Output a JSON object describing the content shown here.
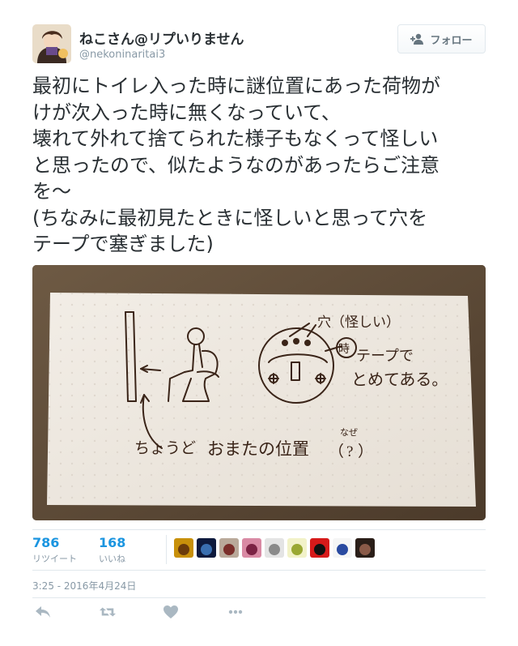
{
  "user": {
    "display_name": "ねこさん@リプいりません",
    "handle": "@nekoninaritai3",
    "avatar_icon": "avatar-icon"
  },
  "follow_button": {
    "label": "フォロー",
    "icon": "add-user-icon"
  },
  "tweet": {
    "text": "最初にトイレ入った時に謎位置にあった荷物が\nけが次入った時に無くなっていて、\n壊れて外れて捨てられた様子もなくって怪しい\nと思ったので、似たようなのがあったらご注意\nを～\n(ちなみに最初見たときに怪しいと思って穴を\nテープで塞ぎました)"
  },
  "photo": {
    "handwriting": {
      "hole_label": "穴（怪しい）",
      "ana_mark": "時",
      "tape_line1": "テープで",
      "tape_line2": "とめてある。",
      "bottom_left": "ちょうど",
      "bottom_right": "おまたの位置",
      "paren_open": "（",
      "paren_q": "?",
      "paren_close": "）",
      "ruby": "なぜ"
    }
  },
  "stats": {
    "retweets": {
      "count": "786",
      "label": "リツイート"
    },
    "likes": {
      "count": "168",
      "label": "いいね"
    }
  },
  "likers": [
    {
      "name": "liker-1",
      "colors": [
        "#c8900a",
        "#6b3b0a"
      ]
    },
    {
      "name": "liker-2",
      "colors": [
        "#0e1a3d",
        "#3a6fb0"
      ]
    },
    {
      "name": "liker-3",
      "colors": [
        "#b9a99a",
        "#7a2e2a"
      ]
    },
    {
      "name": "liker-4",
      "colors": [
        "#d98aa4",
        "#7b2243"
      ]
    },
    {
      "name": "liker-5",
      "colors": [
        "#e4e4e4",
        "#8a8a8a"
      ]
    },
    {
      "name": "liker-6",
      "colors": [
        "#f2f2c8",
        "#9aa832"
      ]
    },
    {
      "name": "liker-7",
      "colors": [
        "#d61a1a",
        "#111111"
      ]
    },
    {
      "name": "liker-8",
      "colors": [
        "#f5f5f5",
        "#2a4aa0"
      ]
    },
    {
      "name": "liker-9",
      "colors": [
        "#2a1e18",
        "#8a5a48"
      ]
    }
  ],
  "timestamp": "3:25 - 2016年4月24日",
  "actions": [
    {
      "name": "reply-icon"
    },
    {
      "name": "retweet-icon"
    },
    {
      "name": "like-icon"
    },
    {
      "name": "more-icon"
    }
  ],
  "colors": {
    "accent": "#1b95e0",
    "muted": "#8899a6",
    "text": "#292f33",
    "action_icon": "#aab8c2"
  }
}
